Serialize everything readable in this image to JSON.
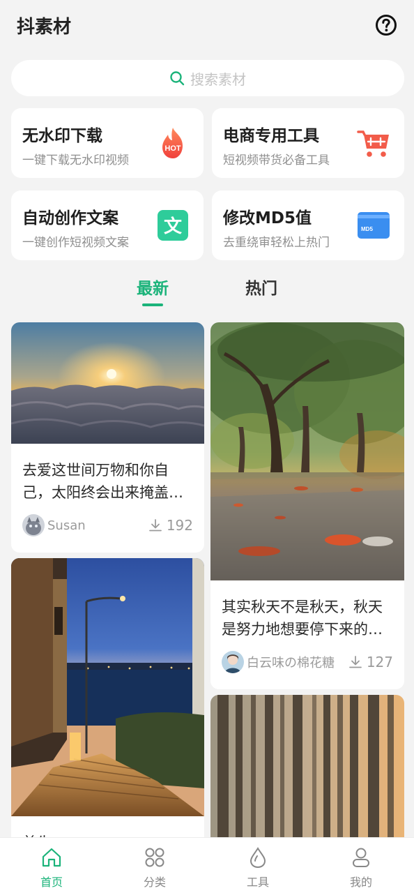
{
  "header": {
    "title": "抖素材",
    "help_icon": "question-circle-icon"
  },
  "search": {
    "placeholder": "搜索素材",
    "icon": "search-icon",
    "accent": "#1bb37a"
  },
  "tools": [
    {
      "title": "无水印下载",
      "subtitle": "一键下载无水印视频",
      "icon": "hot-flame-icon",
      "badge": "HOT",
      "color": "#f25c4a"
    },
    {
      "title": "电商专用工具",
      "subtitle": "短视频带货必备工具",
      "icon": "shopping-cart-icon",
      "color": "#f25c4a"
    },
    {
      "title": "自动创作文案",
      "subtitle": "一键创作短视频文案",
      "icon": "text-doc-icon",
      "glyph": "文",
      "color": "#2ecc9a"
    },
    {
      "title": "修改MD5值",
      "subtitle": "去重绕审轻松上热门",
      "icon": "md5-card-icon",
      "badge": "MD5",
      "color": "#3a8ef0"
    }
  ],
  "tabs": [
    {
      "label": "最新",
      "active": true
    },
    {
      "label": "热门",
      "active": false
    }
  ],
  "feed": [
    {
      "title": "去爱这世间万物和你自己，太阳终会出来掩盖所有",
      "author": "Susan",
      "downloads": "192",
      "image": "sunrise-over-clouds"
    },
    {
      "title": "其实秋天不是秋天，秋天是努力地想要停下来的夏天",
      "author": "白云味の棉花糖",
      "downloads": "127",
      "image": "autumn-trees-wet-road"
    },
    {
      "title": "首先，",
      "image": "night-stairs-by-the-sea"
    },
    {
      "image": "misty-forest-sunlight"
    }
  ],
  "nav": [
    {
      "label": "首页",
      "icon": "home-icon",
      "active": true
    },
    {
      "label": "分类",
      "icon": "grid-icon",
      "active": false
    },
    {
      "label": "工具",
      "icon": "drop-icon",
      "active": false
    },
    {
      "label": "我的",
      "icon": "user-icon",
      "active": false
    }
  ],
  "colors": {
    "accent": "#1bb37a",
    "background": "#f3f3f3",
    "card": "#ffffff"
  }
}
